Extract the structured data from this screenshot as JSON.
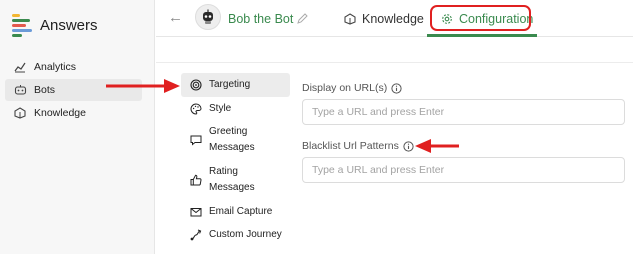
{
  "brand": {
    "name": "Answers"
  },
  "sidebar": {
    "items": [
      {
        "label": "Analytics",
        "icon": "analytics-icon",
        "active": false
      },
      {
        "label": "Bots",
        "icon": "bot-icon",
        "active": true
      },
      {
        "label": "Knowledge",
        "icon": "knowledge-icon",
        "active": false
      }
    ]
  },
  "header": {
    "back_icon": "back-arrow-icon",
    "bot_name": "Bob the Bot",
    "tabs": [
      {
        "label": "Knowledge",
        "icon": "knowledge-icon",
        "active": false
      },
      {
        "label": "Configuration",
        "icon": "gear-icon",
        "active": true
      }
    ]
  },
  "settings_menu": {
    "items": [
      {
        "label": "Targeting",
        "icon": "target-icon",
        "active": true
      },
      {
        "label": "Style",
        "icon": "palette-icon",
        "active": false
      },
      {
        "label": "Greeting Messages",
        "icon": "message-icon",
        "active": false
      },
      {
        "label": "Rating Messages",
        "icon": "thumbs-up-icon",
        "active": false
      },
      {
        "label": "Email Capture",
        "icon": "mail-icon",
        "active": false
      },
      {
        "label": "Custom Journey",
        "icon": "journey-icon",
        "active": false
      }
    ]
  },
  "form": {
    "display_url": {
      "label": "Display on URL(s)",
      "value": "",
      "placeholder": "Type a URL and press Enter"
    },
    "blacklist": {
      "label": "Blacklist Url Patterns",
      "value": "",
      "placeholder": "Type a URL and press Enter"
    }
  },
  "colors": {
    "accent": "#3a8a4e",
    "annotation": "#e02020",
    "sidebar_bg": "#f7f7f7",
    "active_bg": "#ececec"
  }
}
